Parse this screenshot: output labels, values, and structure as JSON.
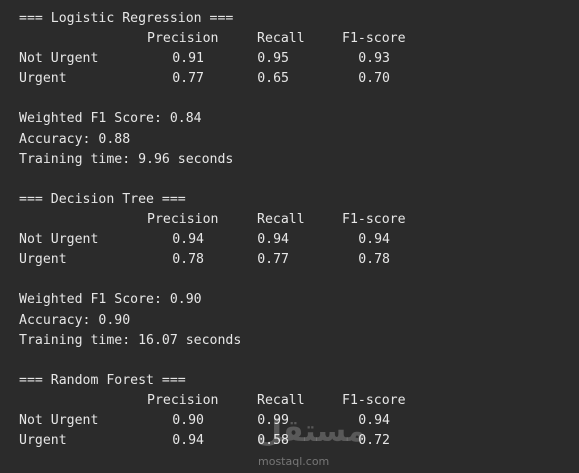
{
  "sections": [
    {
      "header": "=== Logistic Regression ===",
      "columns": [
        "Precision",
        "Recall",
        "F1-score"
      ],
      "rows": [
        {
          "label": "Not Urgent",
          "precision": "0.91",
          "recall": "0.95",
          "f1": "0.93"
        },
        {
          "label": "Urgent",
          "precision": "0.77",
          "recall": "0.65",
          "f1": "0.70"
        }
      ],
      "weighted_f1": "Weighted F1 Score: 0.84",
      "accuracy": "Accuracy: 0.88",
      "training_time": "Training time: 9.96 seconds"
    },
    {
      "header": "=== Decision Tree ===",
      "columns": [
        "Precision",
        "Recall",
        "F1-score"
      ],
      "rows": [
        {
          "label": "Not Urgent",
          "precision": "0.94",
          "recall": "0.94",
          "f1": "0.94"
        },
        {
          "label": "Urgent",
          "precision": "0.78",
          "recall": "0.77",
          "f1": "0.78"
        }
      ],
      "weighted_f1": "Weighted F1 Score: 0.90",
      "accuracy": "Accuracy: 0.90",
      "training_time": "Training time: 16.07 seconds"
    },
    {
      "header": "=== Random Forest ===",
      "columns": [
        "Precision",
        "Recall",
        "F1-score"
      ],
      "rows": [
        {
          "label": "Not Urgent",
          "precision": "0.90",
          "recall": "0.99",
          "f1": "0.94"
        },
        {
          "label": "Urgent",
          "precision": "0.94",
          "recall": "0.58",
          "f1": "0.72"
        }
      ]
    }
  ],
  "watermark": {
    "glyph": "مستقل",
    "text": "mostaql.com"
  }
}
